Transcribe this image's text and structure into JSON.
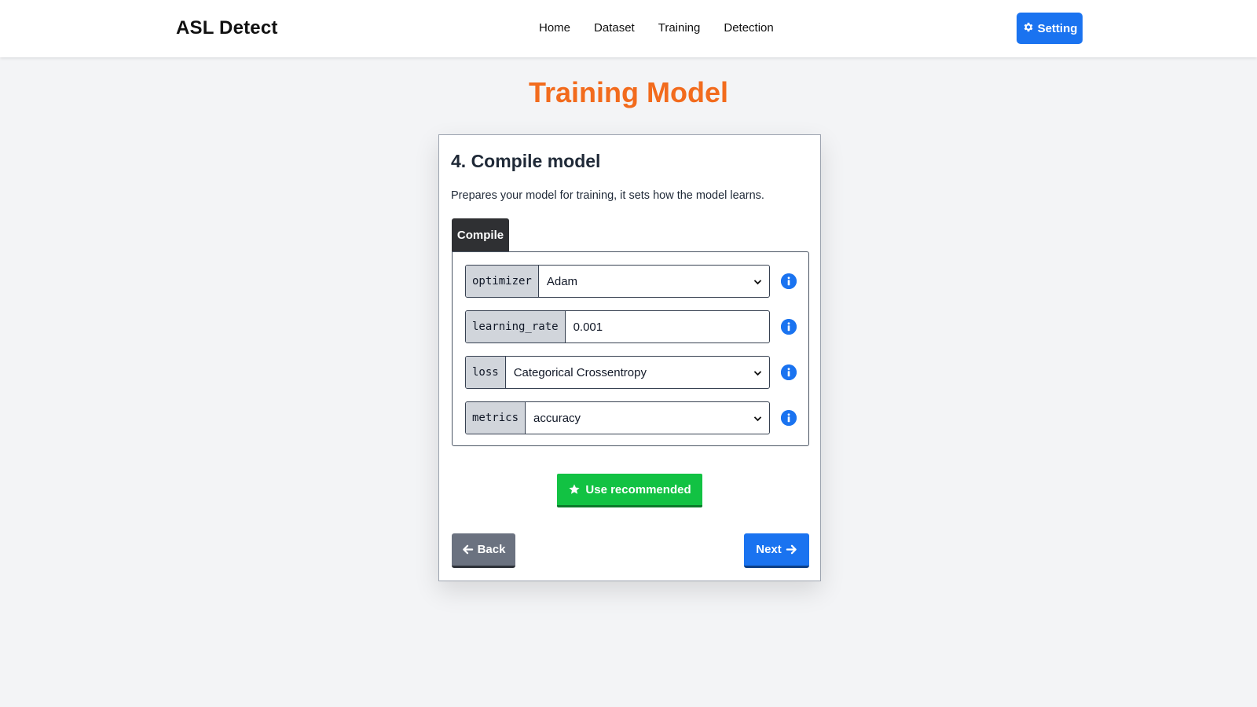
{
  "header": {
    "brand": "ASL Detect",
    "nav": [
      "Home",
      "Dataset",
      "Training",
      "Detection"
    ],
    "setting_label": "Setting",
    "setting_icon": "gear-icon",
    "accent_color": "#1a73f0"
  },
  "page": {
    "title": "Training Model",
    "title_color": "#f26b1d"
  },
  "step": {
    "title": "4. Compile model",
    "description": "Prepares your model for training, it sets how the model learns.",
    "tab_label": "Compile",
    "fields": [
      {
        "label": "optimizer",
        "type": "select",
        "value": "Adam"
      },
      {
        "label": "learning_rate",
        "type": "input",
        "value": "0.001"
      },
      {
        "label": "loss",
        "type": "select",
        "value": "Categorical Crossentropy"
      },
      {
        "label": "metrics",
        "type": "select",
        "value": "accuracy"
      }
    ],
    "info_icon": "info-icon",
    "recommend_label": "Use recommended",
    "recommend_icon": "star-icon",
    "recommend_color": "#12c243",
    "back_label": "Back",
    "back_icon": "arrow-left-icon",
    "next_label": "Next",
    "next_icon": "arrow-right-icon"
  }
}
